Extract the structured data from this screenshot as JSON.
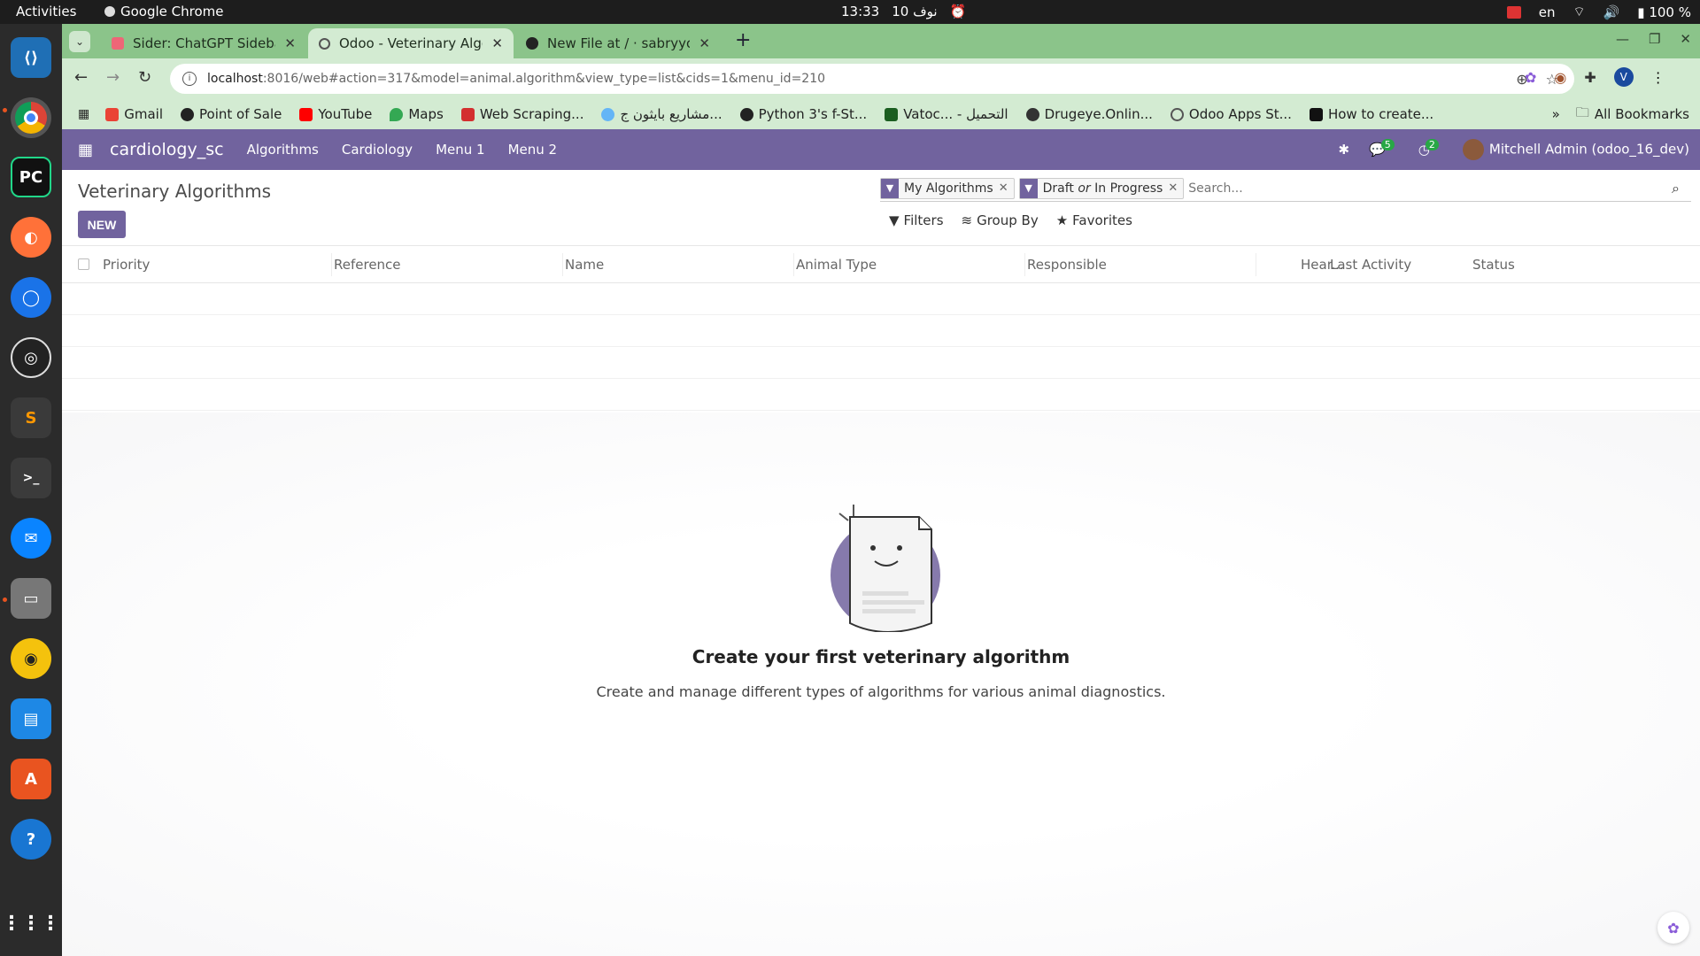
{
  "topbar": {
    "activities": "Activities",
    "app": "Google Chrome",
    "time": "13:33",
    "date": "10 نوف",
    "lang": "en",
    "battery": "100 %"
  },
  "browser": {
    "tabs": [
      {
        "title": "Sider: ChatGPT Sidebar +",
        "active": false
      },
      {
        "title": "Odoo - Veterinary Algorithms",
        "active": true
      },
      {
        "title": "New File at / · sabryyousef",
        "active": false
      }
    ],
    "url_host": "localhost",
    "url_rest": ":8016/web#action=317&model=animal.algorithm&view_type=list&cids=1&menu_id=210",
    "profile_initial": "V",
    "bookmarks": [
      "Gmail",
      "Point of Sale",
      "YouTube",
      "Maps",
      "Web Scraping...",
      "مشاريع بايثون ج...",
      "Python 3's f-St...",
      "Vatoc... - التحميل",
      "Drugeye.Onlin...",
      "Odoo Apps St...",
      "How to create..."
    ],
    "all_bookmarks": "All Bookmarks"
  },
  "odoo": {
    "brand": "cardiology_sc",
    "menus": [
      "Algorithms",
      "Cardiology",
      "Menu 1",
      "Menu 2"
    ],
    "messages_count": "5",
    "activities_count": "2",
    "user": "Mitchell Admin (odoo_16_dev)",
    "page_title": "Veterinary Algorithms",
    "new_label": "NEW",
    "facets": [
      {
        "label": "My Algorithms"
      },
      {
        "label_a": "Draft",
        "label_or": "or",
        "label_b": "In Progress"
      }
    ],
    "search_placeholder": "Search...",
    "filters_label": "Filters",
    "groupby_label": "Group By",
    "favorites_label": "Favorites",
    "columns": [
      "Priority",
      "Reference",
      "Name",
      "Animal Type",
      "Responsible",
      "Hear...",
      "Last Activity",
      "Status"
    ],
    "empty_title": "Create your first veterinary algorithm",
    "empty_text": "Create and manage different types of algorithms for various animal diagnostics."
  }
}
